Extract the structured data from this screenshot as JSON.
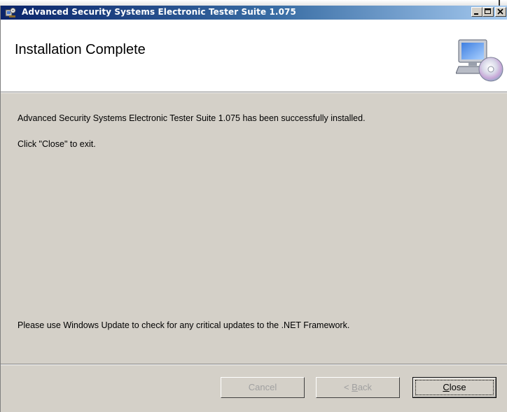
{
  "window": {
    "title": "Advanced Security Systems Electronic Tester Suite 1.075"
  },
  "header": {
    "title": "Installation Complete",
    "graphic_icon": "computer-cd-icon"
  },
  "body": {
    "line1": "Advanced Security Systems Electronic Tester Suite 1.075 has been successfully installed.",
    "line2": "Click \"Close\" to exit.",
    "line3": "Please use Windows Update to check for any critical updates to the .NET Framework."
  },
  "buttons": {
    "cancel": "Cancel",
    "back_prefix": "< ",
    "back_mnemonic": "B",
    "back_rest": "ack",
    "close_mnemonic": "C",
    "close_rest": "lose"
  },
  "colors": {
    "titlebar_start": "#0a246a",
    "titlebar_end": "#a6caf0",
    "dialog_face": "#d4d0c8",
    "header_bg": "#ffffff"
  }
}
